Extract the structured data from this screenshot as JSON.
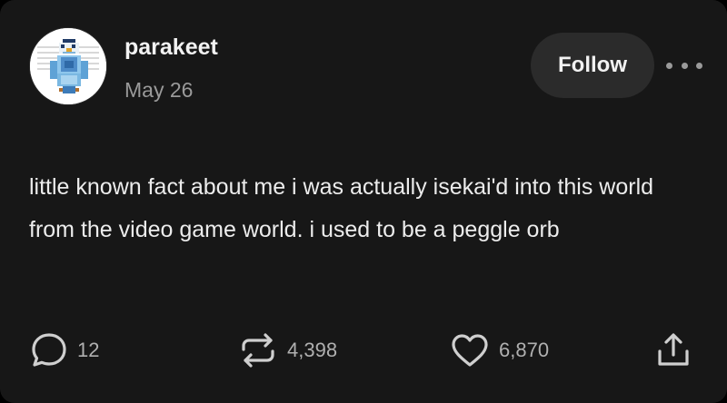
{
  "post": {
    "author": "parakeet",
    "date": "May 26",
    "follow_label": "Follow",
    "body": "little known fact about me i was actually isekai'd into this world from the video game world. i used to be a peggle orb"
  },
  "actions": {
    "replies": "12",
    "reblogs": "4,398",
    "likes": "6,870"
  },
  "icons": {
    "avatar": "parakeet-pixel-avatar",
    "more": "more-horizontal-icon",
    "reply": "speech-bubble-icon",
    "reblog": "repost-arrows-icon",
    "like": "heart-icon",
    "share": "share-upload-icon"
  },
  "colors": {
    "background": "#171717",
    "text": "#ececec",
    "muted": "#9a9a9a",
    "button": "#2b2b2b"
  }
}
